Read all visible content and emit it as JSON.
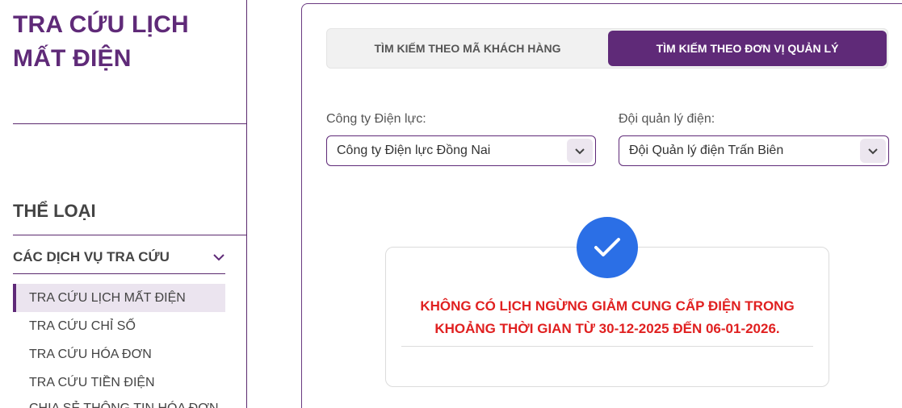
{
  "sidebar": {
    "title": "TRA CỨU LỊCH MẤT ĐIỆN",
    "section_heading": "THỂ LOẠI",
    "group_label": "CÁC DỊCH VỤ TRA CỨU",
    "group_expanded": true,
    "items": [
      {
        "label": "TRA CỨU LỊCH MẤT ĐIỆN",
        "active": true
      },
      {
        "label": "TRA CỨU CHỈ SỐ",
        "active": false
      },
      {
        "label": "TRA CỨU HÓA ĐƠN",
        "active": false
      },
      {
        "label": "TRA CỨU TIỀN ĐIỆN",
        "active": false
      },
      {
        "label": "CHIA SẺ THÔNG TIN HÓA ĐƠN",
        "active": false
      }
    ]
  },
  "tabs": [
    {
      "label": "TÌM KIẾM THEO MÃ KHÁCH HÀNG",
      "active": false
    },
    {
      "label": "TÌM KIẾM THEO ĐƠN VỊ QUẢN LÝ",
      "active": true
    }
  ],
  "filters": {
    "company": {
      "label": "Công ty Điện lực:",
      "value": "Công ty Điện lực Đồng Nai"
    },
    "team": {
      "label": "Đội quản lý điện:",
      "value": "Đội Quản lý điện Trấn Biên"
    }
  },
  "result": {
    "icon": "check-icon",
    "message": "KHÔNG CÓ LỊCH NGỪNG GIẢM CUNG CẤP ĐIỆN TRONG KHOẢNG THỜI GIAN TỪ 30-12-2025 ĐẾN 06-01-2026."
  },
  "colors": {
    "brand_purple": "#5f2a78",
    "accent_blue": "#2b6fe6",
    "alert_red": "#e02020"
  }
}
